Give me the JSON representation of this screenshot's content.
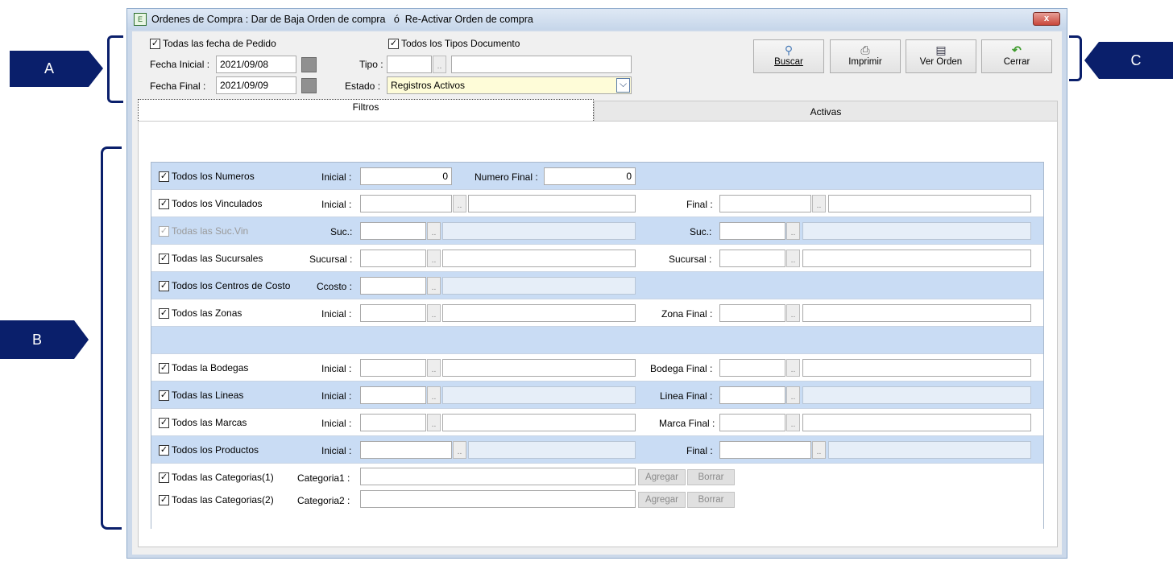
{
  "window": {
    "title": "Ordenes de Compra : Dar de Baja Orden de compra   ó  Re-Activar Orden de compra",
    "close": "x"
  },
  "callouts": {
    "a": "A",
    "b": "B",
    "c": "C"
  },
  "header": {
    "all_dates_label": "Todas las fecha de Pedido",
    "all_doc_types_label": "Todos los Tipos Documento",
    "fecha_inicial_label": "Fecha Inicial :",
    "fecha_inicial_value": "2021/09/08",
    "fecha_final_label": "Fecha Final  :",
    "fecha_final_value": "2021/09/09",
    "tipo_label": "Tipo :",
    "estado_label": "Estado :",
    "estado_value": "Registros Activos"
  },
  "toolbar": {
    "buscar": "Buscar",
    "imprimir": "Imprimir",
    "ver_orden": "Ver Orden",
    "cerrar": "Cerrar"
  },
  "tabs": {
    "filtros": "Filtros",
    "activas": "Activas"
  },
  "filters": {
    "numeros": {
      "check": "Todos los Numeros",
      "inicial_label": "Inicial :",
      "inicial_value": "0",
      "final_label": "Numero Final :",
      "final_value": "0"
    },
    "vinculados": {
      "check": "Todos los Vinculados",
      "inicial_label": "Inicial :",
      "final_label": "Final :"
    },
    "suc_vin": {
      "check": "Todas las Suc.Vin",
      "left_label": "Suc.:",
      "right_label": "Suc.:"
    },
    "sucursales": {
      "check": "Todas las Sucursales",
      "left_label": "Sucursal :",
      "right_label": "Sucursal :"
    },
    "centros": {
      "check": "Todos los Centros de Costo",
      "left_label": "Ccosto :"
    },
    "zonas": {
      "check": "Todos las Zonas",
      "inicial_label": "Inicial :",
      "final_label": "Zona Final :"
    },
    "bodegas": {
      "check": "Todas la Bodegas",
      "inicial_label": "Inicial :",
      "final_label": "Bodega Final :"
    },
    "lineas": {
      "check": "Todas las Lineas",
      "inicial_label": "Inicial :",
      "final_label": "Linea Final :"
    },
    "marcas": {
      "check": "Todos las Marcas",
      "inicial_label": "Inicial :",
      "final_label": "Marca Final :"
    },
    "productos": {
      "check": "Todos los Productos",
      "inicial_label": "Inicial :",
      "final_label": "Final :"
    },
    "categorias1": {
      "check": "Todas las Categorias(1)",
      "label": "Categoria1 :"
    },
    "categorias2": {
      "check": "Todas las Categorias(2)",
      "label": "Categoria2 :"
    },
    "agregar": "Agregar",
    "borrar": "Borrar",
    "dots": ".."
  },
  "icons": {
    "check_mark": "✓",
    "dropdown_arrow": "⌵",
    "app_icon": "E"
  }
}
